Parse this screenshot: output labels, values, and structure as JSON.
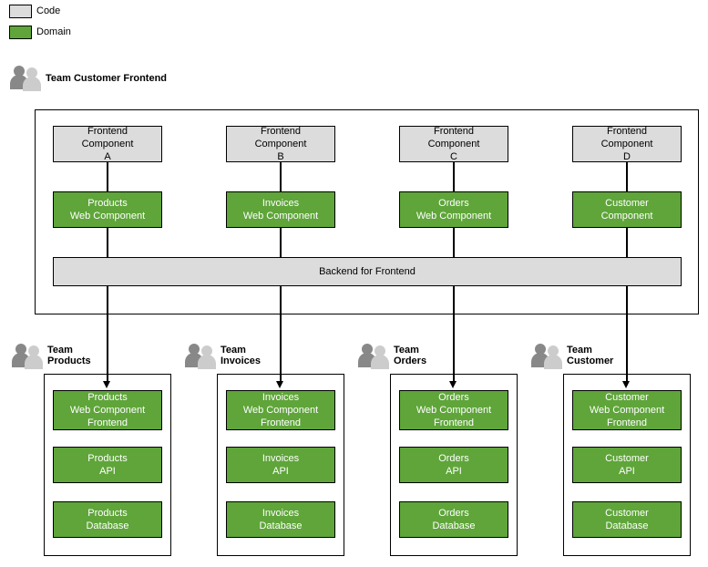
{
  "legend": {
    "code": "Code",
    "domain": "Domain"
  },
  "team_label": "Team Customer Frontend",
  "frontend": {
    "a": "Frontend\nComponent\nA",
    "b": "Frontend\nComponent\nB",
    "c": "Frontend\nComponent\nC",
    "d": "Frontend\nComponent\nD"
  },
  "web": {
    "products": "Products\nWeb Component",
    "invoices": "Invoices\nWeb Component",
    "orders": "Orders\nWeb Component",
    "customer": "Customer\nComponent"
  },
  "bff": "Backend for Frontend",
  "teams": {
    "products": {
      "title": "Team\nProducts",
      "fe": "Products\nWeb Component\nFrontend",
      "api": "Products\nAPI",
      "db": "Products\nDatabase"
    },
    "invoices": {
      "title": "Team\nInvoices",
      "fe": "Invoices\nWeb Component\nFrontend",
      "api": "Invoices\nAPI",
      "db": "Invoices\nDatabase"
    },
    "orders": {
      "title": "Team\nOrders",
      "fe": "Orders\nWeb Component\nFrontend",
      "api": "Orders\nAPI",
      "db": "Orders\nDatabase"
    },
    "customer": {
      "title": "Team\nCustomer",
      "fe": "Customer\nWeb Component\nFrontend",
      "api": "Customer\nAPI",
      "db": "Customer\nDatabase"
    }
  }
}
